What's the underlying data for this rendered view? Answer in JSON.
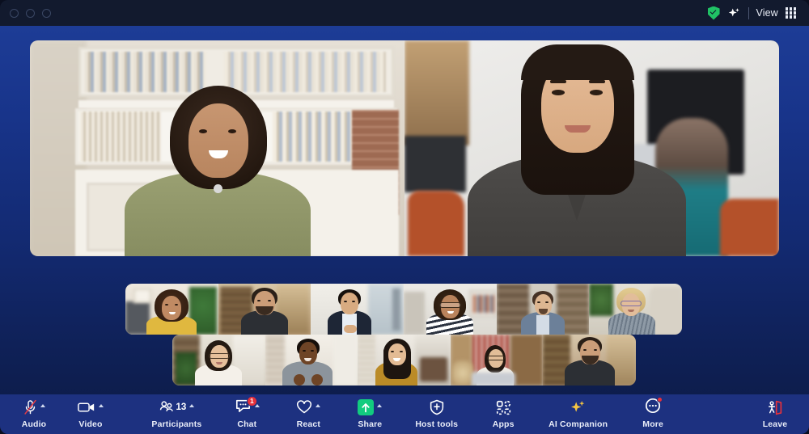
{
  "window": {
    "traffic_lights": [
      "close",
      "minimize",
      "maximize"
    ],
    "right_controls": {
      "encryption_icon": "shield-check-icon",
      "ai_icon": "sparkle-icon",
      "view_label": "View",
      "view_icon": "grid-icon"
    }
  },
  "meeting": {
    "speakers": [
      {
        "name": "speaker-tile-1",
        "description": "Woman with curly hair in olive top, bookshelf background"
      },
      {
        "name": "speaker-tile-2",
        "description": "Woman with dark bob hair in grey sweater, office background"
      }
    ],
    "thumbnail_rows": [
      {
        "row": 1,
        "participants": [
          "Woman in yellow top with plants",
          "Bearded man in dark tee, loft background",
          "Man in navy blazer by window",
          "Woman with glasses in striped top",
          "Man in blue shirt, bookshelf background",
          "Woman with blonde hair and glasses"
        ]
      },
      {
        "row": 2,
        "participants": [
          "Woman with glasses in white patterned top",
          "Man gesturing in grey shirt, brick wall",
          "Woman in mustard turtleneck with headset",
          "Woman at laptop with dog, red kitchen",
          "Bearded man in dark tee, loft background"
        ]
      }
    ]
  },
  "toolbar": {
    "left": [
      {
        "id": "audio",
        "label": "Audio",
        "icon": "microphone-muted-icon",
        "muted": true,
        "has_chevron": true
      },
      {
        "id": "video",
        "label": "Video",
        "icon": "video-camera-icon",
        "muted": false,
        "has_chevron": true
      }
    ],
    "center": [
      {
        "id": "participants",
        "label": "Participants",
        "icon": "people-icon",
        "count": "13",
        "has_chevron": true
      },
      {
        "id": "chat",
        "label": "Chat",
        "icon": "chat-bubble-icon",
        "badge": "1",
        "has_chevron": true
      },
      {
        "id": "react",
        "label": "React",
        "icon": "heart-icon",
        "has_chevron": true
      },
      {
        "id": "share",
        "label": "Share",
        "icon": "share-screen-icon",
        "has_chevron": true
      },
      {
        "id": "host-tools",
        "label": "Host tools",
        "icon": "shield-icon",
        "has_chevron": false
      },
      {
        "id": "apps",
        "label": "Apps",
        "icon": "apps-icon",
        "has_chevron": false
      },
      {
        "id": "ai-companion",
        "label": "AI Companion",
        "icon": "sparkle-icon",
        "has_chevron": false
      },
      {
        "id": "more",
        "label": "More",
        "icon": "more-dots-icon",
        "has_dot_badge": true,
        "has_chevron": false
      }
    ],
    "right": [
      {
        "id": "leave",
        "label": "Leave",
        "icon": "leave-door-icon"
      }
    ]
  },
  "colors": {
    "titlebar_bg": "#121a2e",
    "stage_top": "#1d3c96",
    "stage_bottom": "#0c1a44",
    "toolbar_bg": "#1d3180",
    "accent_green": "#12cc7f",
    "badge_red": "#e8313a",
    "leave_red": "#e8313a",
    "ai_yellow": "#f7c948",
    "text_primary": "#e9edf8"
  }
}
